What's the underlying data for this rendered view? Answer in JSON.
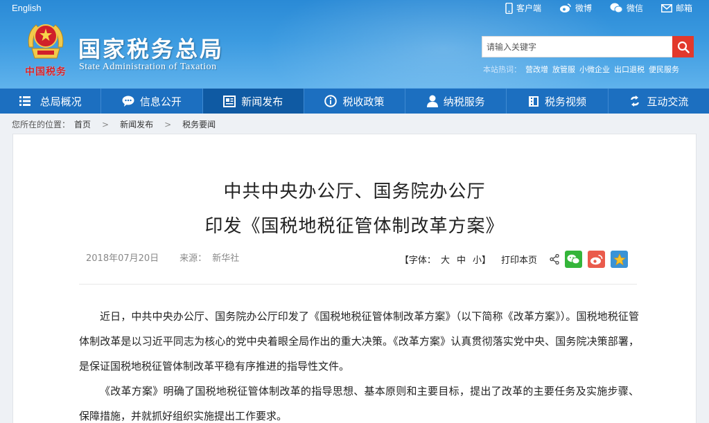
{
  "header": {
    "lang": "English",
    "top_links": [
      {
        "label": "客户端",
        "icon": "mobile-icon"
      },
      {
        "label": "微博",
        "icon": "weibo-icon"
      },
      {
        "label": "微信",
        "icon": "wechat-icon"
      },
      {
        "label": "邮箱",
        "icon": "mail-icon"
      }
    ],
    "seal_text": "中国税务",
    "site_name": "国家税务总局",
    "site_name_en": "State Administration of Taxation",
    "search_placeholder": "请输入关键字",
    "hot_label": "本站热词：",
    "hot_words": [
      "营改增",
      "放管服",
      "小微企业",
      "出口退税",
      "便民服务"
    ]
  },
  "nav": {
    "items": [
      {
        "label": "总局概况",
        "icon": "menu-icon"
      },
      {
        "label": "信息公开",
        "icon": "speech-bubble-icon"
      },
      {
        "label": "新闻发布",
        "icon": "newspaper-icon",
        "active": true
      },
      {
        "label": "税收政策",
        "icon": "info-icon"
      },
      {
        "label": "纳税服务",
        "icon": "person-icon"
      },
      {
        "label": "税务视频",
        "icon": "video-icon"
      },
      {
        "label": "互动交流",
        "icon": "exchange-icon"
      }
    ]
  },
  "breadcrumb": {
    "prefix": "您所在的位置：",
    "items": [
      "首页",
      "新闻发布",
      "税务要闻"
    ],
    "separator": ">"
  },
  "article": {
    "title_line1": "中共中央办公厅、国务院办公厅",
    "title_line2": "印发《国税地税征管体制改革方案》",
    "date": "2018年07月20日",
    "source_label": "来源：",
    "source": "新华社",
    "font_label": "【字体：",
    "font_sizes": [
      "大",
      "中",
      "小】"
    ],
    "print_label": "打印本页",
    "paragraphs": [
      "近日，中共中央办公厅、国务院办公厅印发了《国税地税征管体制改革方案》（以下简称《改革方案》）。国税地税征管体制改革是以习近平同志为核心的党中央着眼全局作出的重大决策。《改革方案》认真贯彻落实党中央、国务院决策部署，是保证国税地税征管体制改革平稳有序推进的指导性文件。",
      "《改革方案》明确了国税地税征管体制改革的指导思想、基本原则和主要目标，提出了改革的主要任务及实施步骤、保障措施，并就抓好组织实施提出工作要求。"
    ]
  },
  "colors": {
    "header_blue": "#2a8ad6",
    "nav_blue": "#1c6fc0",
    "nav_active": "#0f5aa3",
    "search_red": "#e2392c",
    "wechat_green": "#34b53a",
    "weibo_red": "#ea5b4c"
  }
}
